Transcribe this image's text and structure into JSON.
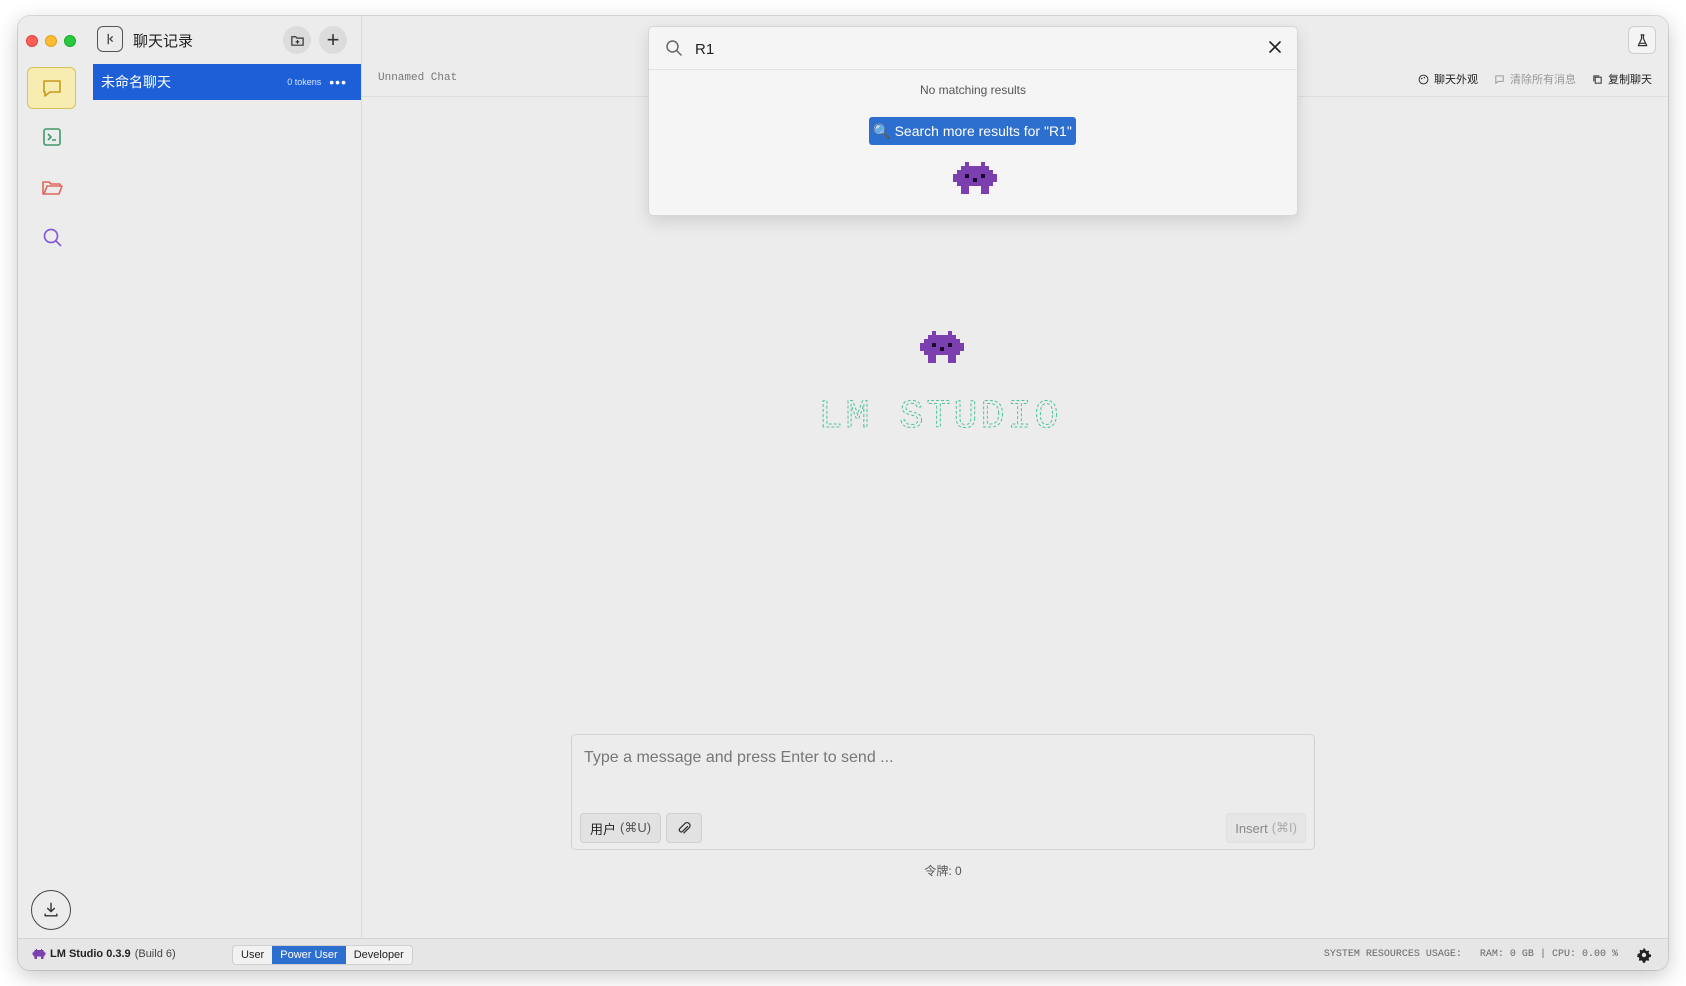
{
  "sidebar": {
    "title": "聊天记录",
    "chats": [
      {
        "name": "未命名聊天",
        "tokens": "0 tokens",
        "more": "•••"
      }
    ],
    "add_glyph": "+"
  },
  "rail": {
    "items": [
      {
        "icon": "chat-bubble-icon",
        "active": true,
        "color": "#d4a72c"
      },
      {
        "icon": "terminal-icon",
        "active": false,
        "color": "#3d9a6a"
      },
      {
        "icon": "folder-open-icon",
        "active": false,
        "color": "#e0665a"
      },
      {
        "icon": "search-icon",
        "active": false,
        "color": "#8a5bd6"
      }
    ],
    "bottom_icon": "download-icon"
  },
  "main": {
    "chat_title": "Unnamed Chat",
    "actions": {
      "appearance": "聊天外观",
      "clear": "清除所有消息",
      "copy": "复制聊天"
    }
  },
  "search": {
    "query": "R1",
    "no_results": "No matching results",
    "more_button": "Search more results for \"R1\"",
    "more_emoji": "🔍"
  },
  "banner": {
    "text": "LM STUDIO",
    "color": "#4fc49a"
  },
  "composer": {
    "placeholder": "Type a message and press Enter to send ...",
    "role_label": "用户",
    "role_shortcut": "(⌘U)",
    "insert_label": "Insert",
    "insert_shortcut": "(⌘I)",
    "token_count": "令牌: 0"
  },
  "statusbar": {
    "app_name": "LM Studio 0.3.9",
    "build": "(Build 6)",
    "modes": [
      {
        "label": "User",
        "active": false
      },
      {
        "label": "Power User",
        "active": true
      },
      {
        "label": "Developer",
        "active": false
      }
    ],
    "usage_label": "SYSTEM RESOURCES USAGE:",
    "ram": "RAM: 0 GB",
    "separator": "|",
    "cpu": "CPU: 0.00 %"
  },
  "colors": {
    "accent": "#1c5fd6",
    "button_blue": "#2d6fcf",
    "mascot": "#7b3fb0"
  }
}
